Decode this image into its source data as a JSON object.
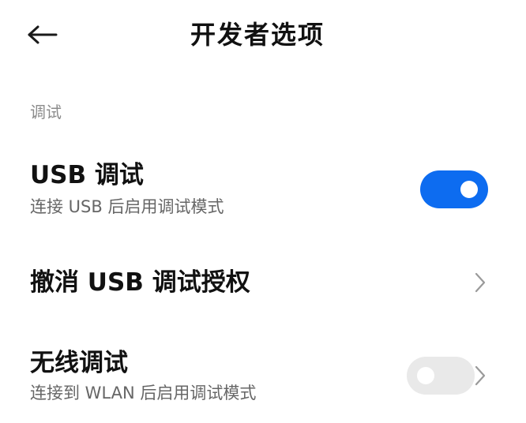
{
  "header": {
    "title": "开发者选项",
    "back_icon": "back-arrow-icon"
  },
  "section": {
    "label": "调试"
  },
  "items": [
    {
      "title": "USB 调试",
      "subtitle": "连接 USB 后启用调试模式",
      "control": "toggle",
      "enabled": true
    },
    {
      "title": "撤消 USB 调试授权",
      "control": "chevron",
      "icon": "chevron-right-icon"
    },
    {
      "title": "无线调试",
      "subtitle": "连接到 WLAN 后启用调试模式",
      "control": "toggle+chevron",
      "enabled": false,
      "icon": "chevron-right-icon"
    }
  ],
  "colors": {
    "accent": "#0d6cf0",
    "toggle_off": "#e9e9e9",
    "section_label": "#8b8b8b",
    "subtitle": "#666666",
    "title": "#111111"
  }
}
